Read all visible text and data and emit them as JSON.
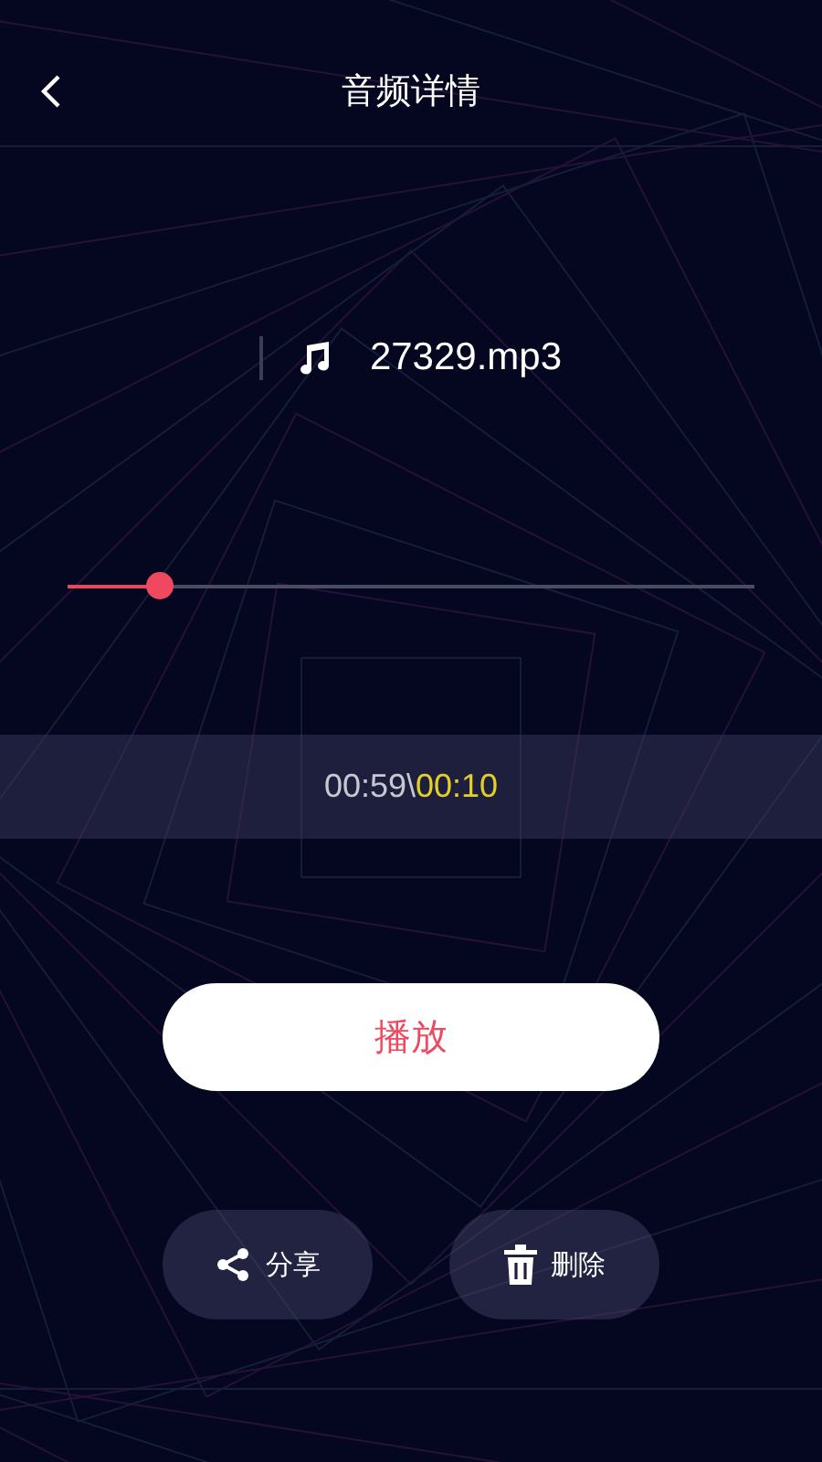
{
  "header": {
    "title": "音频详情"
  },
  "file": {
    "name": "27329.mp3"
  },
  "progress": {
    "level": 0.127
  },
  "time": {
    "total": "00:59",
    "separator": "\\",
    "current": "00:10"
  },
  "play_button": "播放",
  "actions": [
    {
      "kind": "share",
      "label": "分享"
    },
    {
      "kind": "delete",
      "label": "删除"
    }
  ]
}
